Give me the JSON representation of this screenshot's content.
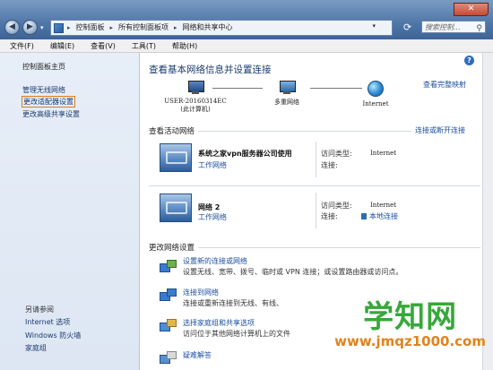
{
  "address": {
    "crumbs": [
      "控制面板",
      "所有控制面板项",
      "网络和共享中心"
    ]
  },
  "search": {
    "placeholder": "搜索控制..."
  },
  "menu": [
    "文件(F)",
    "编辑(E)",
    "查看(V)",
    "工具(T)",
    "帮助(H)"
  ],
  "sidebar": {
    "home": "控制面板主页",
    "links": [
      "管理无线网络",
      "更改适配器设置",
      "更改高级共享设置"
    ],
    "see_also_title": "另请参阅",
    "see_also": [
      "Internet 选项",
      "Windows 防火墙",
      "家庭组"
    ]
  },
  "main": {
    "heading": "查看基本网络信息并设置连接",
    "view_full_map": "查看完整映射",
    "map": {
      "computer": "USER-20160314EC",
      "computer_sub": "(此计算机)",
      "multiple": "多重网络",
      "internet": "Internet"
    },
    "active_title": "查看活动网络",
    "connect_disconnect": "连接或断开连接",
    "networks": [
      {
        "name": "系统之家vpn服务器公司使用",
        "type": "工作网络",
        "access_label": "访问类型:",
        "access": "Internet",
        "conn_label": "连接:",
        "conn": ""
      },
      {
        "name": "网络  2",
        "type": "工作网络",
        "access_label": "访问类型:",
        "access": "Internet",
        "conn_label": "连接:",
        "conn": "本地连接"
      }
    ],
    "change_title": "更改网络设置",
    "tasks": [
      {
        "title": "设置新的连接或网络",
        "desc": "设置无线、宽带、拨号、临时或 VPN 连接；或设置路由器或访问点。"
      },
      {
        "title": "连接到网络",
        "desc": "连接或重新连接到无线、有线、"
      },
      {
        "title": "选择家庭组和共享选项",
        "desc": "访问位于其他网络计算机上的文件"
      },
      {
        "title": "疑难解答",
        "desc": ""
      }
    ]
  },
  "watermark": {
    "big": "学知网",
    "small": "www.jmqz1000.com"
  }
}
